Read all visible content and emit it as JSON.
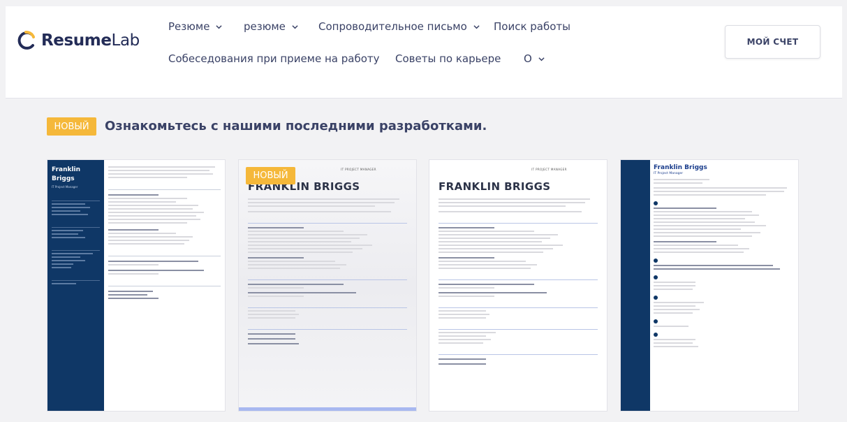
{
  "brand": {
    "name_bold": "Resume",
    "name_light": "Lab"
  },
  "nav": {
    "row1": [
      {
        "label": "Резюме",
        "has_dropdown": true
      },
      {
        "label": "резюме",
        "has_dropdown": true
      },
      {
        "label": "Сопроводительное письмо",
        "has_dropdown": true
      },
      {
        "label": "Поиск работы",
        "has_dropdown": false
      }
    ],
    "row2": [
      {
        "label": "Собеседования при приеме на работу",
        "has_dropdown": false
      },
      {
        "label": "Советы по карьере",
        "has_dropdown": false
      },
      {
        "label": "О",
        "has_dropdown": true
      }
    ],
    "account_label": "МОЙ СЧЕТ"
  },
  "promo": {
    "badge": "НОВЫЙ",
    "text": "Ознакомьтесь с нашими последними разработками."
  },
  "cards": {
    "card1": {
      "name_first": "Franklin",
      "name_last": "Briggs",
      "role": "IT Project Manager"
    },
    "card2": {
      "badge": "НОВЫЙ",
      "name": "FRANKLIN BRIGGS",
      "role": "IT PROJECT MANAGER"
    },
    "card3": {
      "name": "FRANKLIN BRIGGS",
      "role": "IT PROJECT MANAGER"
    },
    "card4": {
      "name": "Franklin Briggs",
      "role": "IT Project Manager"
    }
  },
  "colors": {
    "brand_navy": "#232c57",
    "badge": "#f5b83a",
    "resume_navy": "#0f3766",
    "accent_blue": "#a8b8f0"
  }
}
